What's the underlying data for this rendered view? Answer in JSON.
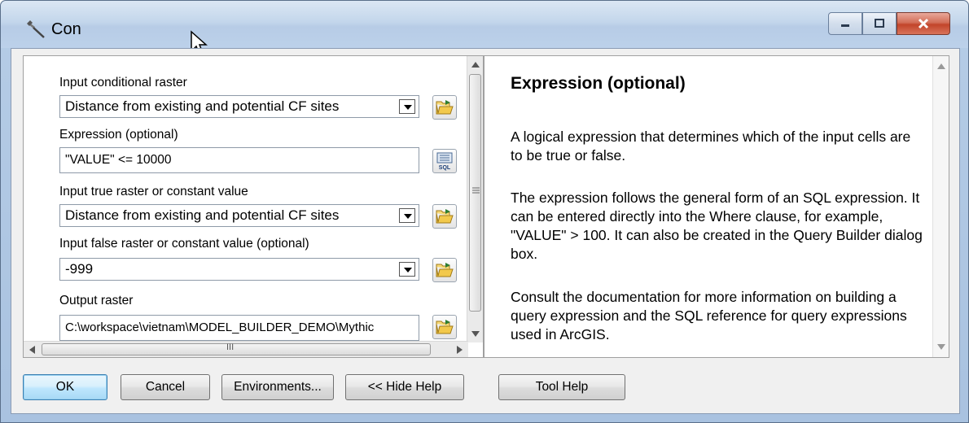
{
  "window": {
    "title": "Con"
  },
  "params": {
    "input_conditional_raster": {
      "label": "Input conditional raster",
      "value": "Distance from existing and potential CF sites"
    },
    "expression": {
      "label": "Expression (optional)",
      "value": "\"VALUE\" <= 10000"
    },
    "input_true": {
      "label": "Input true raster or constant value",
      "value": "Distance from existing and potential CF sites"
    },
    "input_false": {
      "label": "Input false raster or constant value (optional)",
      "value": "-999"
    },
    "output_raster": {
      "label": "Output raster",
      "value": "C:\\workspace\\vietnam\\MODEL_BUILDER_DEMO\\Mythic"
    }
  },
  "help": {
    "title": "Expression (optional)",
    "paragraphs": [
      "A logical expression that determines which of the input cells are to be true or false.",
      "The expression follows the general form of an SQL expression. It can be entered directly into the Where clause, for example, \"VALUE\" > 100. It can also be created in the Query Builder dialog box.",
      "Consult the documentation for more information on building a query expression and the SQL reference for query expressions used in ArcGIS."
    ]
  },
  "buttons": {
    "ok": "OK",
    "cancel": "Cancel",
    "environments": "Environments...",
    "hide_help": "<< Hide Help",
    "tool_help": "Tool Help"
  },
  "sql_icon_text": "SQL",
  "scroll_thumb_glyph": "III"
}
